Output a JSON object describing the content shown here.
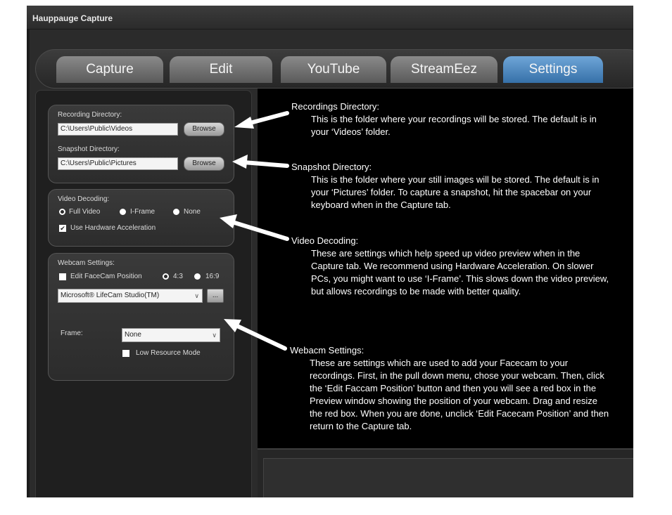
{
  "window": {
    "title": "Hauppauge Capture"
  },
  "tabs": [
    {
      "label": "Capture"
    },
    {
      "label": "Edit"
    },
    {
      "label": "YouTube"
    },
    {
      "label": "StreamEez"
    },
    {
      "label": "Settings",
      "active": true
    }
  ],
  "settings": {
    "recording_label": "Recording Directory:",
    "recording_value": "C:\\Users\\Public\\Videos",
    "snapshot_label": "Snapshot Directory:",
    "snapshot_value": "C:\\Users\\Public\\Pictures",
    "browse_label": "Browse",
    "decoding_label": "Video Decoding:",
    "decoding_options": [
      "Full Video",
      "I-Frame",
      "None"
    ],
    "decoding_selected": "Full Video",
    "hw_accel_label": "Use Hardware Acceleration",
    "hw_accel_checked": true,
    "webcam_label": "Webcam Settings:",
    "facecam_label": "Edit FaceCam Position",
    "facecam_checked": false,
    "aspect_options": [
      "4:3",
      "16:9"
    ],
    "aspect_selected": "4:3",
    "webcam_device": "Microsoft® LifeCam Studio(TM)",
    "more_button": "...",
    "frame_label": "Frame:",
    "frame_value": "None",
    "low_resource_label": "Low Resource Mode",
    "low_resource_checked": false
  },
  "annotations": {
    "recordings_title": "Recordings Directory:",
    "recordings_text": "This is the folder where your recordings will be stored. The default is in your ‘Videos’ folder.",
    "snapshot_title": "Snapshot Directory:",
    "snapshot_text": "This is the folder where your still images will be stored. The default is in your ‘Pictures’ folder. To capture a snapshot, hit the spacebar on your keyboard when in the Capture tab.",
    "decoding_title": "Video Decoding:",
    "decoding_text": "These are settings which help speed up video preview when in the Capture tab. We recommend using Hardware Acceleration. On slower PCs, you might want to use ‘I-Frame’. This slows down the video preview, but allows recordings to be made with better quality.",
    "webcam_title": "Webacm Settings:",
    "webcam_text": "These are settings which are used to add your Facecam to your recordings. First, in the pull down menu, chose your webcam. Then, click the ‘Edit Faccam Position’ button and then you will see a red box in the Preview window showing the position of your webcam. Drag and resize the red box. When you are done, unclick ‘Edit Facecam Position’ and then return to the Capture tab."
  },
  "colors": {
    "active_tab": "#4a87c2",
    "background": "#2b2b2b",
    "preview": "#000000"
  }
}
